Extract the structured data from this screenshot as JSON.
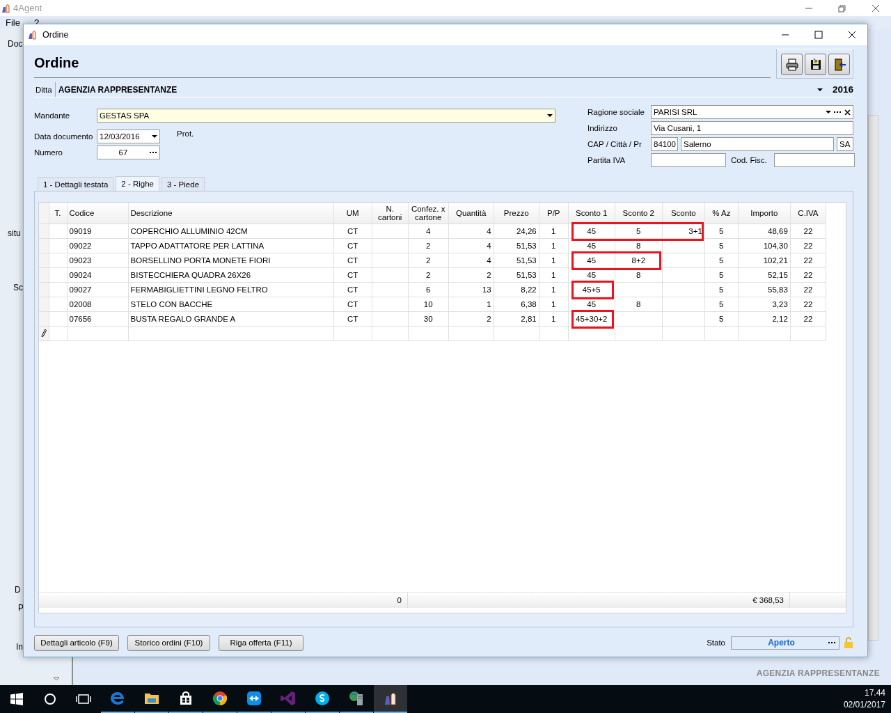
{
  "app": {
    "title": "4Agent",
    "menu": [
      "File",
      "?"
    ],
    "sidebar_fragments": [
      "Doc",
      "situ",
      "Sc",
      "D",
      "P",
      "In"
    ],
    "footer_company": "AGENZIA RAPPRESENTANZE"
  },
  "dialog": {
    "title": "Ordine",
    "heading": "Ordine",
    "ditta": {
      "label": "Ditta",
      "value": "AGENZIA RAPPRESENTANZE",
      "year": "2016"
    },
    "mandante": {
      "label": "Mandante",
      "value": "GESTAS SPA"
    },
    "data_documento": {
      "label": "Data documento",
      "value": "12/03/2016"
    },
    "prot_label": "Prot.",
    "numero": {
      "label": "Numero",
      "value": "67"
    },
    "ragione_sociale": {
      "label": "Ragione sociale",
      "value": "PARISI SRL"
    },
    "indirizzo": {
      "label": "Indirizzo",
      "value": "Via Cusani, 1"
    },
    "cap_citta_pr": {
      "label": "CAP / Città / Pr",
      "cap": "84100",
      "citta": "Salerno",
      "provincia": "SA"
    },
    "partita_iva": {
      "label": "Partita IVA"
    },
    "cod_fisc": {
      "label": "Cod. Fisc."
    },
    "tabs": [
      {
        "label": "1 - Dettagli testata",
        "selected": false
      },
      {
        "label": "2 - Righe",
        "selected": true
      },
      {
        "label": "3 - Piede",
        "selected": false
      }
    ],
    "table": {
      "columns": [
        "T.",
        "Codice",
        "Descrizione",
        "UM",
        "N. cartoni",
        "Confez. x cartone",
        "Quantità",
        "Prezzo",
        "P/P",
        "Sconto 1",
        "Sconto 2",
        "Sconto",
        "% Az",
        "Importo",
        "C.IVA"
      ],
      "rows": [
        {
          "cells": [
            "",
            "09019",
            "COPERCHIO ALLUMINIO 42CM",
            "CT",
            "",
            "4",
            "4",
            "24,26",
            "1",
            "45",
            "5",
            "3+1",
            "5",
            "48,69",
            "22"
          ],
          "highlight": {
            "kind": "span3"
          }
        },
        {
          "cells": [
            "",
            "09022",
            "TAPPO ADATTATORE PER LATTINA",
            "CT",
            "",
            "2",
            "4",
            "51,53",
            "1",
            "45",
            "8",
            "",
            "5",
            "104,30",
            "22"
          ]
        },
        {
          "cells": [
            "",
            "09023",
            "BORSELLINO PORTA MONETE FIORI",
            "CT",
            "",
            "2",
            "4",
            "51,53",
            "1",
            "45",
            "8+2",
            "",
            "5",
            "102,21",
            "22"
          ],
          "highlight": {
            "kind": "span2"
          }
        },
        {
          "cells": [
            "",
            "09024",
            "BISTECCHIERA QUADRA 26X26",
            "CT",
            "",
            "2",
            "2",
            "51,53",
            "1",
            "45",
            "8",
            "",
            "5",
            "52,15",
            "22"
          ]
        },
        {
          "cells": [
            "",
            "09027",
            "FERMABIGLIETTINI LEGNO FELTRO",
            "CT",
            "",
            "6",
            "13",
            "8,22",
            "1",
            "45+5",
            "",
            "",
            "5",
            "55,83",
            "22"
          ],
          "highlight": {
            "kind": "span1"
          }
        },
        {
          "cells": [
            "",
            "02008",
            "STELO CON BACCHE",
            "CT",
            "",
            "10",
            "1",
            "6,38",
            "1",
            "45",
            "8",
            "",
            "5",
            "3,23",
            "22"
          ]
        },
        {
          "cells": [
            "",
            "07656",
            "BUSTA REGALO GRANDE A",
            "CT",
            "",
            "30",
            "2",
            "2,81",
            "1",
            "45+30+2",
            "",
            "",
            "5",
            "2,12",
            "22"
          ],
          "highlight": {
            "kind": "span1"
          }
        }
      ],
      "totals": {
        "n_cartoni": "0",
        "importo": "€ 368,53"
      }
    },
    "buttons": [
      "Dettagli articolo (F9)",
      "Storico ordini (F10)",
      "Riga offerta (F11)"
    ],
    "stato": {
      "label": "Stato",
      "value": "Aperto"
    }
  },
  "taskbar": {
    "apps": [
      {
        "kind": "edge",
        "running": true,
        "selected": false
      },
      {
        "kind": "folder",
        "running": true,
        "selected": false
      },
      {
        "kind": "store",
        "running": true,
        "selected": false
      },
      {
        "kind": "chrome",
        "running": true,
        "selected": false
      },
      {
        "kind": "remote",
        "running": true,
        "selected": false
      },
      {
        "kind": "studio",
        "running": true,
        "selected": false
      },
      {
        "kind": "skype",
        "running": true,
        "selected": false
      },
      {
        "kind": "server",
        "running": true,
        "selected": false
      },
      {
        "kind": "agent",
        "running": true,
        "selected": true
      }
    ],
    "time": "17.44",
    "date": "02/01/2017"
  }
}
